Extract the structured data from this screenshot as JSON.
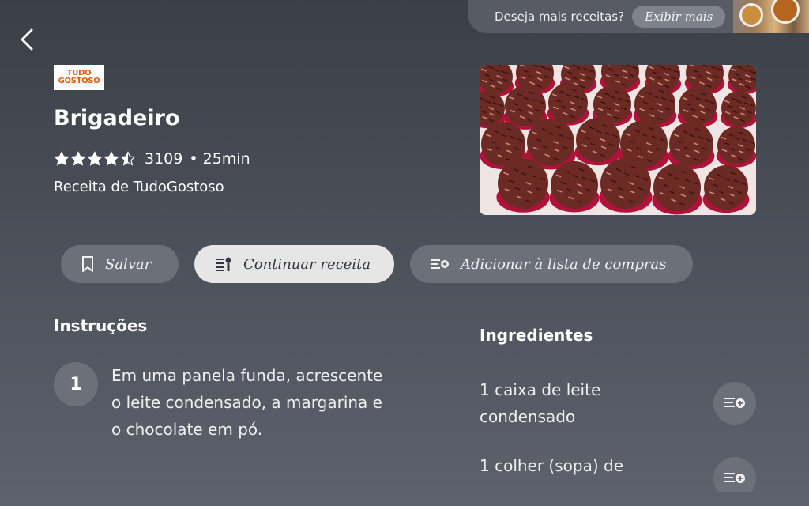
{
  "topbar": {
    "prompt": "Deseja mais receitas?",
    "button_label": "Exibir mais",
    "thumbnail_icon": "recipe-thumbnail"
  },
  "back_icon": "chevron-left-icon",
  "brand": {
    "logo_line1": "TUDO",
    "logo_line2": "GOSTOSO",
    "logo_color": "#e85a0c"
  },
  "recipe": {
    "title": "Brigadeiro",
    "rating_value": 4.5,
    "rating_count": "3109",
    "duration": "• 25min",
    "source": "Receita de TudoGostoso"
  },
  "actions": {
    "save_label": "Salvar",
    "continue_label": "Continuar receita",
    "add_list_label": "Adicionar à lista de compras"
  },
  "instructions": {
    "heading": "Instruções",
    "steps": [
      {
        "number": "1",
        "text": "Em uma panela funda, acrescente o leite condensado, a margarina e o chocolate em pó."
      }
    ]
  },
  "ingredients": {
    "heading": "Ingredientes",
    "items": [
      {
        "text": "1 caixa de leite condensado"
      },
      {
        "text": "1 colher (sopa) de"
      }
    ]
  },
  "colors": {
    "background_top": "#3b3f47",
    "pill": "#6b7079",
    "pill_active": "#e6e6e6"
  }
}
